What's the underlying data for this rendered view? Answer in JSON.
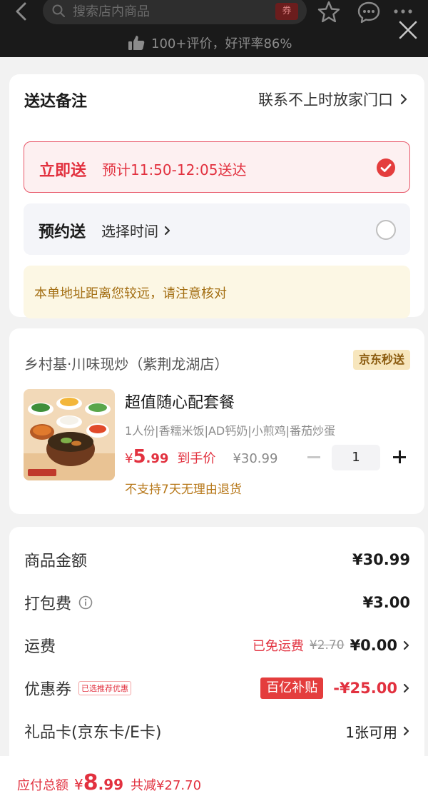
{
  "header": {
    "search_placeholder": "搜索店内商品",
    "coupon_icon_text": "券",
    "rating_text": "100+评价，好评率86%"
  },
  "delivery": {
    "note_label": "送达备注",
    "note_value": "联系不上时放家门口",
    "options": [
      {
        "title": "立即送",
        "subtitle": "预计11:50-12:05送达",
        "selected": true
      },
      {
        "title": "预约送",
        "subtitle": "选择时间",
        "selected": false
      }
    ],
    "warning": "本单地址距离您较远，请注意核对"
  },
  "store": {
    "name": "乡村基·川味现炒（紫荆龙湖店）",
    "badge": "京东秒送",
    "product": {
      "name": "超值随心配套餐",
      "desc": "1人份|香糯米饭|AD钙奶|小煎鸡|番茄炒蛋",
      "price_symbol": "¥",
      "price_int": "5",
      "price_dec": ".99",
      "price_tag": "到手价",
      "original_price": "¥30.99",
      "quantity": "1",
      "return_note": "不支持7天无理由退货"
    }
  },
  "fees": {
    "subtotal_label": "商品金额",
    "subtotal_value": "¥30.99",
    "packing_label": "打包费",
    "packing_value": "¥3.00",
    "shipping_label": "运费",
    "shipping_free": "已免运费",
    "shipping_original": "¥2.70",
    "shipping_value": "¥0.00",
    "coupon_label": "优惠券",
    "coupon_tag": "已选推荐优惠",
    "coupon_subsidy": "百亿补贴",
    "coupon_value": "-¥25.00",
    "gift_label": "礼品卡(京东卡/E卡)",
    "gift_value": "1张可用"
  },
  "footer": {
    "total_label": "应付总额",
    "total_symbol": "¥",
    "total_int": "8",
    "total_dec": ".99",
    "saved_text": "共减¥27.70"
  },
  "colors": {
    "accent_red": "#e2313f",
    "warning_text": "#a36e12",
    "badge_bg": "#f7e6bd"
  }
}
